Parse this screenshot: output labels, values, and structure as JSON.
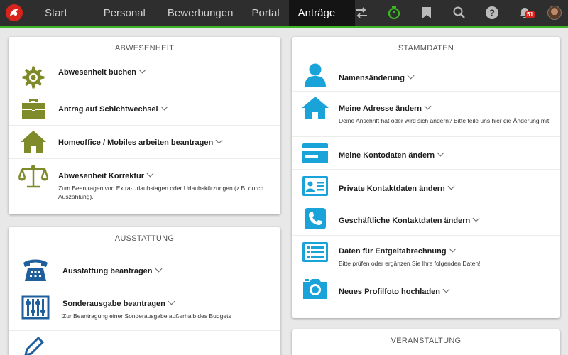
{
  "nav": {
    "tabs": [
      "Start",
      "Personal",
      "Bewerbungen",
      "Portal",
      "Anträge"
    ],
    "active_tab": "Anträge",
    "notifications_count": "51",
    "icons": [
      "swap-icon",
      "stopwatch-icon",
      "bookmark-icon",
      "search-icon",
      "help-icon",
      "bell-icon",
      "avatar"
    ]
  },
  "colors": {
    "accent_green": "#3cb526",
    "icon_olive": "#7f8a2a",
    "icon_blue": "#1aa3d9",
    "icon_navy": "#1f5f9c"
  },
  "abwesenheit": {
    "title": "ABWESENHEIT",
    "items": [
      {
        "label": "Abwesenheit buchen",
        "icon": "gear-icon"
      },
      {
        "label": "Antrag auf Schichtwechsel",
        "icon": "briefcase-icon"
      },
      {
        "label": "Homeoffice / Mobiles arbeiten beantragen",
        "icon": "home-icon"
      },
      {
        "label": "Abwesenheit Korrektur",
        "icon": "scale-icon",
        "description": "Zum Beantragen von Extra-Urlaubstagen oder Urlaubskürzungen (z.B. durch Auszahlung)."
      }
    ]
  },
  "ausstattung": {
    "title": "AUSSTATTUNG",
    "items": [
      {
        "label": "Ausstattung beantragen",
        "icon": "phone-icon"
      },
      {
        "label": "Sonderausgabe beantragen",
        "icon": "abacus-icon",
        "description": "Zur Beantragung einer Sonderausgabe außerhalb des Budgets"
      }
    ]
  },
  "stammdaten": {
    "title": "STAMMDATEN",
    "items": [
      {
        "label": "Namensänderung",
        "icon": "person-icon"
      },
      {
        "label": "Meine Adresse ändern",
        "icon": "home-icon",
        "description": "Deine Anschrift hat oder wird sich ändern? Bitte teile uns hier die Änderung mit!"
      },
      {
        "label": "Meine Kontodaten ändern",
        "icon": "credit-card-icon"
      },
      {
        "label": "Private Kontaktdaten ändern",
        "icon": "id-card-icon"
      },
      {
        "label": "Geschäftliche Kontaktdaten ändern",
        "icon": "phone-icon"
      },
      {
        "label": "Daten für Entgeltabrechnung",
        "icon": "list-icon",
        "description": "Bitte prüfen oder ergänzen Sie Ihre folgenden Daten!"
      },
      {
        "label": "Neues Profilfoto hochladen",
        "icon": "camera-icon"
      }
    ]
  },
  "veranstaltung": {
    "title": "VERANSTALTUNG"
  }
}
